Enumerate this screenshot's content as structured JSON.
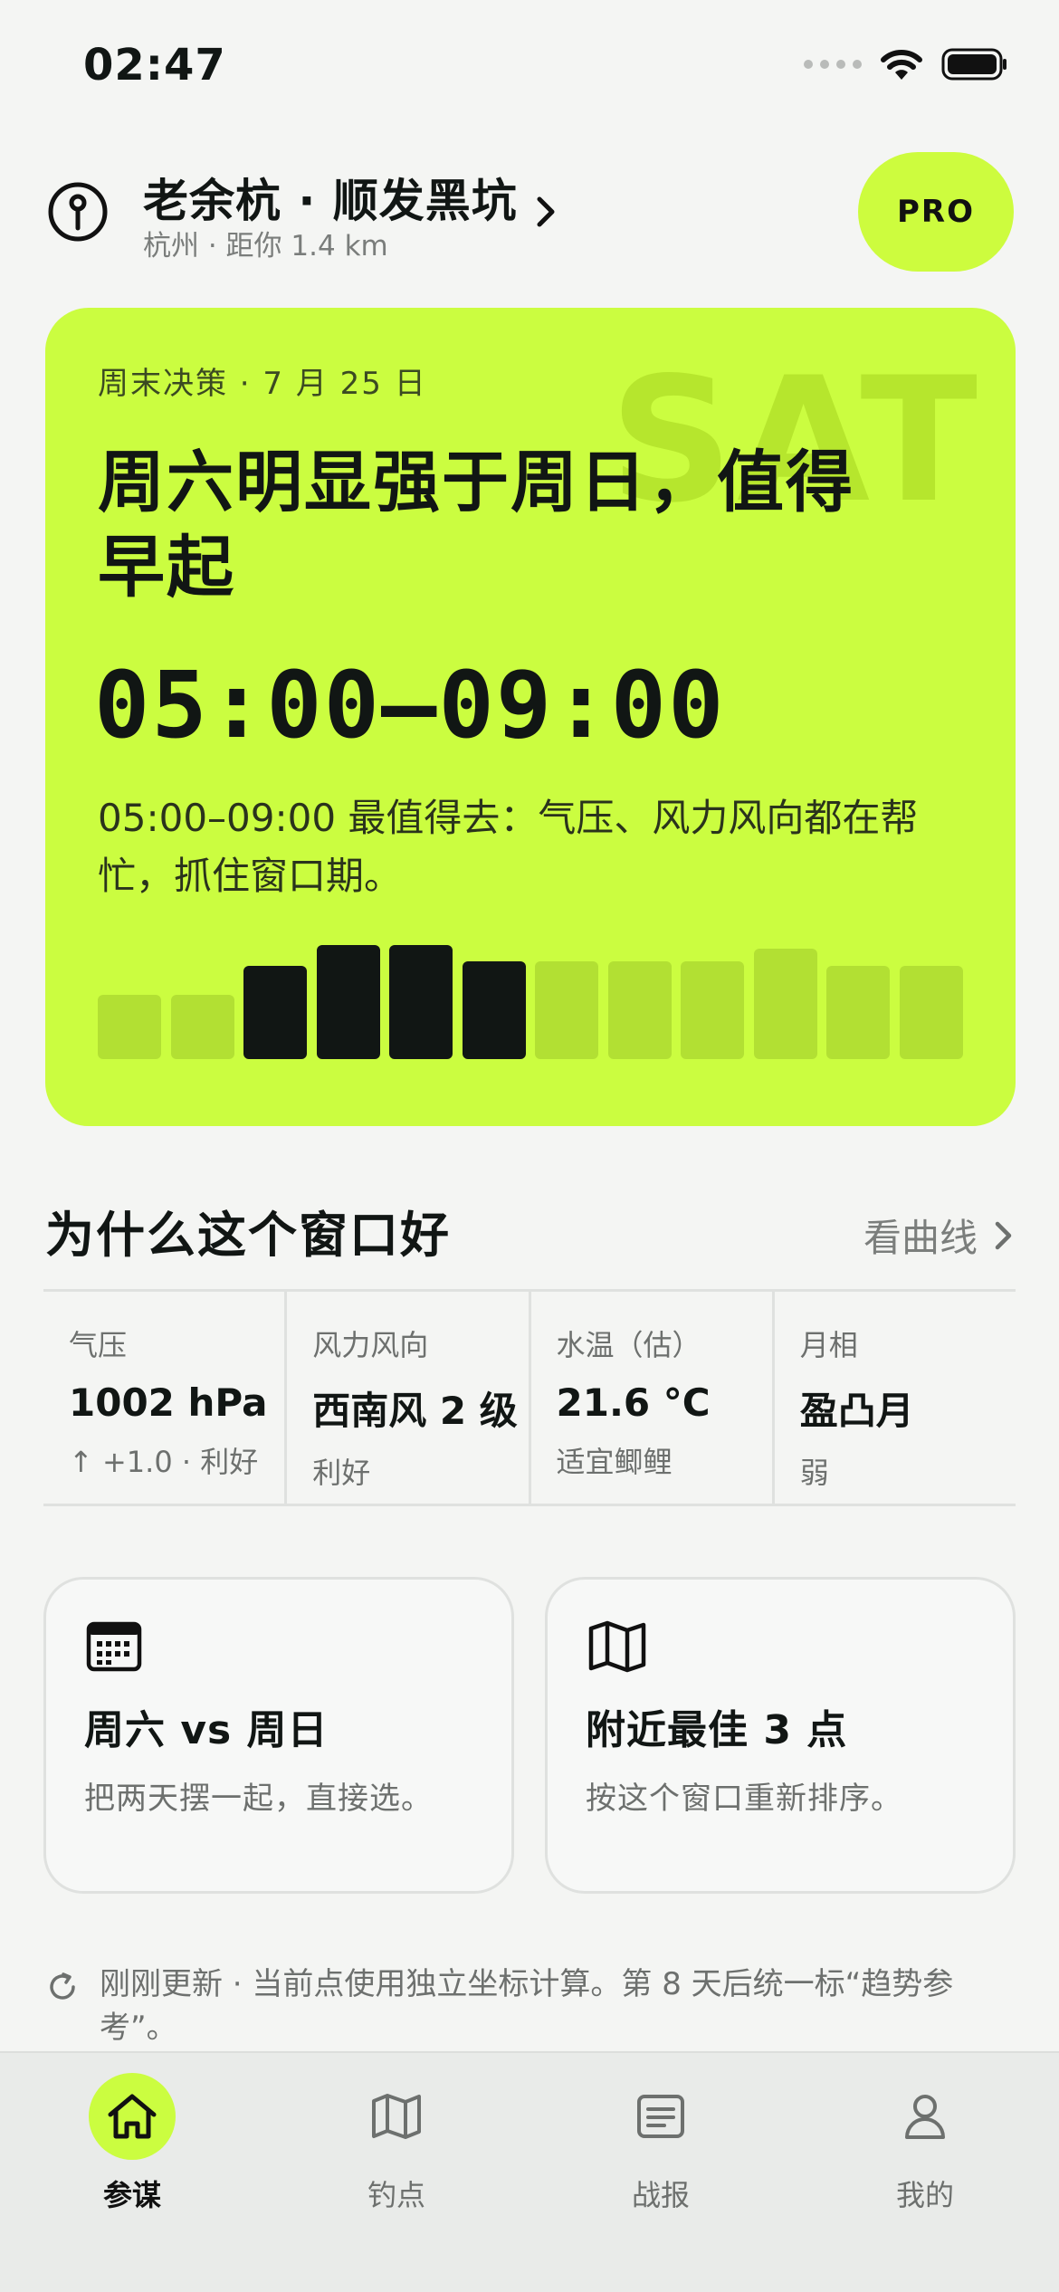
{
  "status_bar": {
    "time": "02:47"
  },
  "header": {
    "spot_name": "老余杭 · 顺发黑坑",
    "spot_sub": "杭州 · 距你 1.4 km",
    "pro_label": "PRO"
  },
  "hero": {
    "watermark": "SAT",
    "tag": "周末决策 · 7 月 25 日",
    "title": "周六明显强于周日，值得早起",
    "time_window": "05:00–09:00",
    "description": "05:00–09:00 最值得去：气压、风力风向都在帮忙，抓住窗口期。",
    "bars": [
      {
        "level": 0.56,
        "highlight": false
      },
      {
        "level": 0.56,
        "highlight": false
      },
      {
        "level": 0.82,
        "highlight": true
      },
      {
        "level": 1.0,
        "highlight": true
      },
      {
        "level": 1.0,
        "highlight": true
      },
      {
        "level": 0.86,
        "highlight": true
      },
      {
        "level": 0.86,
        "highlight": false
      },
      {
        "level": 0.86,
        "highlight": false
      },
      {
        "level": 0.86,
        "highlight": false
      },
      {
        "level": 0.97,
        "highlight": false
      },
      {
        "level": 0.82,
        "highlight": false
      },
      {
        "level": 0.82,
        "highlight": false
      }
    ],
    "colors": {
      "bg": "#cbfd40",
      "bar_dim": "#b2e033",
      "bar_active": "#111614"
    }
  },
  "why": {
    "title": "为什么这个窗口好",
    "curve_link": "看曲线",
    "metrics": [
      {
        "label": "气压",
        "value": "1002 hPa",
        "note": "↑ +1.0 · 利好"
      },
      {
        "label": "风力风向",
        "value": "西南风 2 级",
        "note": "利好"
      },
      {
        "label": "水温（估）",
        "value": "21.6 °C",
        "note": "适宜鲫鲤"
      },
      {
        "label": "月相",
        "value": "盈凸月",
        "note": "弱"
      }
    ]
  },
  "cards": [
    {
      "icon": "calendar-icon",
      "title": "周六 vs 周日",
      "sub": "把两天摆一起，直接选。"
    },
    {
      "icon": "map-icon",
      "title": "附近最佳 3 点",
      "sub": "按这个窗口重新排序。"
    }
  ],
  "update_note": "刚刚更新 · 当前点使用独立坐标计算。第 8 天后统一标“趋势参考”。",
  "tabs": [
    {
      "label": "参谋",
      "icon": "home-icon",
      "active": true
    },
    {
      "label": "钓点",
      "icon": "map-icon",
      "active": false
    },
    {
      "label": "战报",
      "icon": "report-icon",
      "active": false
    },
    {
      "label": "我的",
      "icon": "profile-icon",
      "active": false
    }
  ]
}
